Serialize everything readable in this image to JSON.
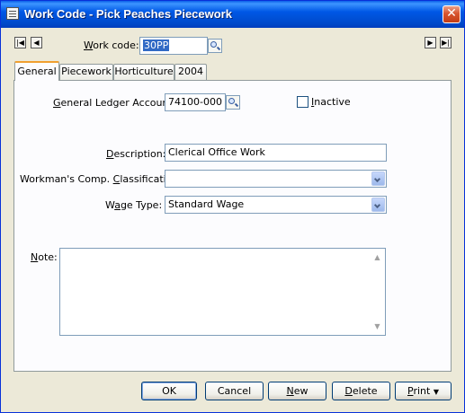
{
  "window": {
    "title": "Work Code - Pick Peaches Piecework"
  },
  "work_code": {
    "label": "Work code:",
    "label_underline": "W",
    "value": "30PP"
  },
  "tabs": [
    "General",
    "Piecework",
    "Horticulture",
    "2004"
  ],
  "active_tab": "General",
  "general": {
    "gl_account": {
      "label": "General Ledger Account:",
      "value": "74100-000"
    },
    "inactive": {
      "label": "Inactive",
      "checked": false
    },
    "description": {
      "label": "Description:",
      "value": "Clerical Office Work"
    },
    "workmans_comp": {
      "label": "Workman's Comp. Classification:",
      "value": ""
    },
    "wage_type": {
      "label": "Wage Type:",
      "value": "Standard Wage"
    },
    "note": {
      "label": "Note:",
      "value": ""
    }
  },
  "buttons": {
    "ok": "OK",
    "cancel": "Cancel",
    "new": "New",
    "delete": "Delete",
    "print": "Print"
  },
  "icons": {
    "first": "first-record-icon",
    "prev": "prev-record-icon",
    "next": "next-record-icon",
    "last": "last-record-icon",
    "lookup": "magnifier-icon",
    "close": "close-icon",
    "dropdown": "chevron-down-icon"
  },
  "colors": {
    "titlebar": "#0058e6",
    "face": "#ece9d8",
    "selection": "#316ac5",
    "close": "#d8542f"
  }
}
